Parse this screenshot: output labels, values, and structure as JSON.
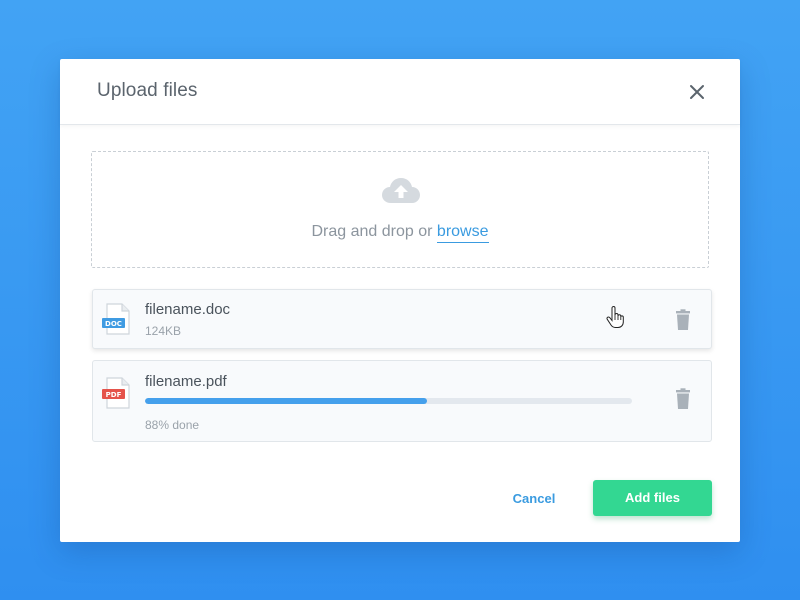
{
  "dialog": {
    "title": "Upload files"
  },
  "dropzone": {
    "prompt": "Drag and drop or",
    "browse_label": "browse"
  },
  "files": [
    {
      "name": "filename.doc",
      "meta": "124KB",
      "type_badge": "DOC",
      "badge_color": "#3f9be2"
    },
    {
      "name": "filename.pdf",
      "meta": "88% done",
      "type_badge": "PDF",
      "badge_color": "#e5534b",
      "progress": 0.58
    }
  ],
  "footer": {
    "cancel_label": "Cancel",
    "add_label": "Add files"
  },
  "colors": {
    "accent": "#3a9be0",
    "primary_button": "#33d792",
    "progress": "#45a0ec",
    "background": "#3a9af2"
  },
  "icons": {
    "close": "close-icon",
    "upload": "cloud-upload-icon",
    "trash": "trash-icon",
    "cursor": "hand-pointer-icon"
  }
}
